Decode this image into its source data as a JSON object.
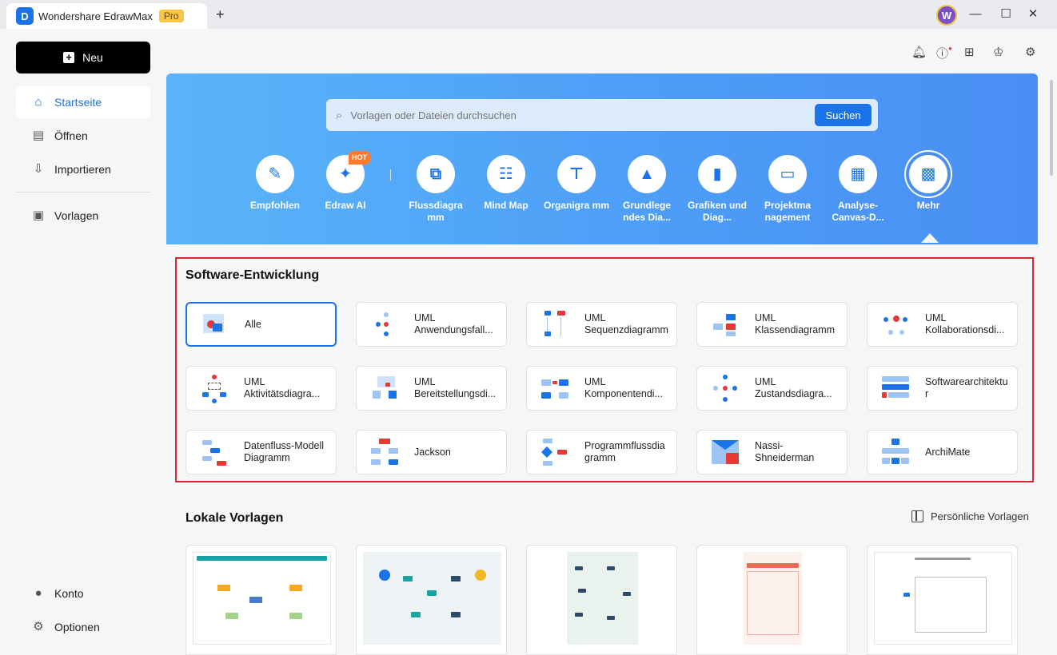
{
  "app": {
    "title": "Wondershare EdrawMax",
    "badge": "Pro",
    "avatar": "W"
  },
  "sidebar": {
    "new_label": "Neu",
    "items": [
      {
        "label": "Startseite",
        "icon": "home-icon"
      },
      {
        "label": "Öffnen",
        "icon": "file-icon"
      },
      {
        "label": "Importieren",
        "icon": "import-icon"
      },
      {
        "label": "Vorlagen",
        "icon": "templates-icon"
      }
    ],
    "bottom": [
      {
        "label": "Konto",
        "icon": "user-icon"
      },
      {
        "label": "Optionen",
        "icon": "gear-icon"
      }
    ]
  },
  "search": {
    "placeholder": "Vorlagen oder Dateien durchsuchen",
    "button": "Suchen"
  },
  "categories": [
    {
      "label": "Empfohlen",
      "icon": "recommend-icon"
    },
    {
      "label": "Edraw AI",
      "icon": "ai-sparkle-icon",
      "badge": "HOT"
    },
    {
      "label": "Flussdiagra mm",
      "icon": "flowchart-icon"
    },
    {
      "label": "Mind Map",
      "icon": "mindmap-icon"
    },
    {
      "label": "Organigra mm",
      "icon": "orgchart-icon"
    },
    {
      "label": "Grundlege ndes Dia...",
      "icon": "basic-diagram-icon"
    },
    {
      "label": "Grafiken und Diag...",
      "icon": "bar-chart-icon"
    },
    {
      "label": "Projektma nagement",
      "icon": "project-icon"
    },
    {
      "label": "Analyse- Canvas-D...",
      "icon": "canvas-icon"
    },
    {
      "label": "Mehr",
      "icon": "more-grid-icon"
    }
  ],
  "software": {
    "title": "Software-Entwicklung",
    "cards": [
      {
        "line1": "Alle",
        "line2": ""
      },
      {
        "line1": "UML",
        "line2": "Anwendungsfall..."
      },
      {
        "line1": "UML",
        "line2": "Sequenzdiagramm"
      },
      {
        "line1": "UML",
        "line2": "Klassendiagramm"
      },
      {
        "line1": "UML",
        "line2": "Kollaborationsdi..."
      },
      {
        "line1": "UML",
        "line2": "Aktivitätsdiagra..."
      },
      {
        "line1": "UML",
        "line2": "Bereitstellungsdi..."
      },
      {
        "line1": "UML",
        "line2": "Komponentendi..."
      },
      {
        "line1": "UML",
        "line2": "Zustandsdiagra..."
      },
      {
        "line1": "Softwarearchitektu",
        "line2": "r"
      },
      {
        "line1": "Datenfluss-Modell",
        "line2": "Diagramm"
      },
      {
        "line1": "Jackson",
        "line2": ""
      },
      {
        "line1": "Programmflussdia",
        "line2": "gramm"
      },
      {
        "line1": "Nassi-",
        "line2": "Shneiderman"
      },
      {
        "line1": "ArchiMate",
        "line2": ""
      }
    ]
  },
  "local": {
    "title": "Lokale Vorlagen",
    "personal": "Persönliche Vorlagen"
  },
  "colors": {
    "accent": "#1a73e8",
    "highlight_border": "#d9282f",
    "hero_start": "#5ab4f8",
    "hero_end": "#4a8ef3"
  }
}
